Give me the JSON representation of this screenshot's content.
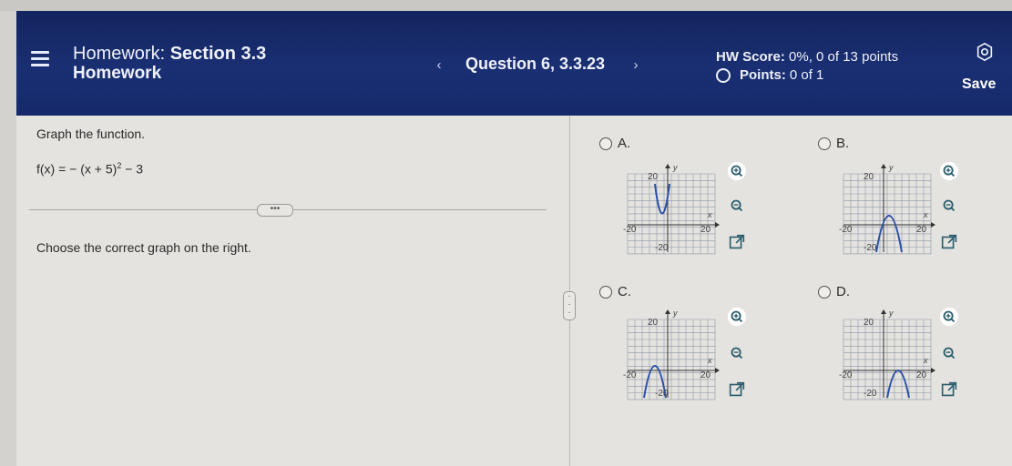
{
  "header": {
    "title_prefix": "Homework: ",
    "title_section": "Section 3.3",
    "title_line2": "Homework",
    "question_label": "Question 6, 3.3.23",
    "hw_score_label": "HW Score: ",
    "hw_score_value": "0%, 0 of 13 points",
    "points_label": "Points: ",
    "points_value": "0 of 1",
    "save_label": "Save",
    "prev_icon": "chevron-left-icon",
    "next_icon": "chevron-right-icon",
    "settings_icon": "gear-icon"
  },
  "left": {
    "prompt": "Graph the function.",
    "formula_main": "f(x) = − (x + 5)",
    "formula_exp": "2",
    "formula_tail": " − 3",
    "more_label": "•••",
    "instruction": "Choose the correct graph on the right."
  },
  "options": [
    {
      "label": "A.",
      "axis_top": "20",
      "axis_bottom": "-20",
      "axis_left": "-20",
      "axis_right": "20",
      "x_label": "x",
      "y_label": "y"
    },
    {
      "label": "B.",
      "axis_top": "20",
      "axis_bottom": "-20",
      "axis_left": "-20",
      "axis_right": "20",
      "x_label": "x",
      "y_label": "y"
    },
    {
      "label": "C.",
      "axis_top": "20",
      "axis_bottom": "-20",
      "axis_left": "-20",
      "axis_right": "20",
      "x_label": "x",
      "y_label": "y"
    },
    {
      "label": "D.",
      "axis_top": "20",
      "axis_bottom": "-20",
      "axis_left": "-20",
      "axis_right": "20",
      "x_label": "x",
      "y_label": "y"
    }
  ],
  "colors": {
    "header_bg": "#15296a",
    "curve": "#2b4fa8",
    "grid": "#8f98a8"
  }
}
